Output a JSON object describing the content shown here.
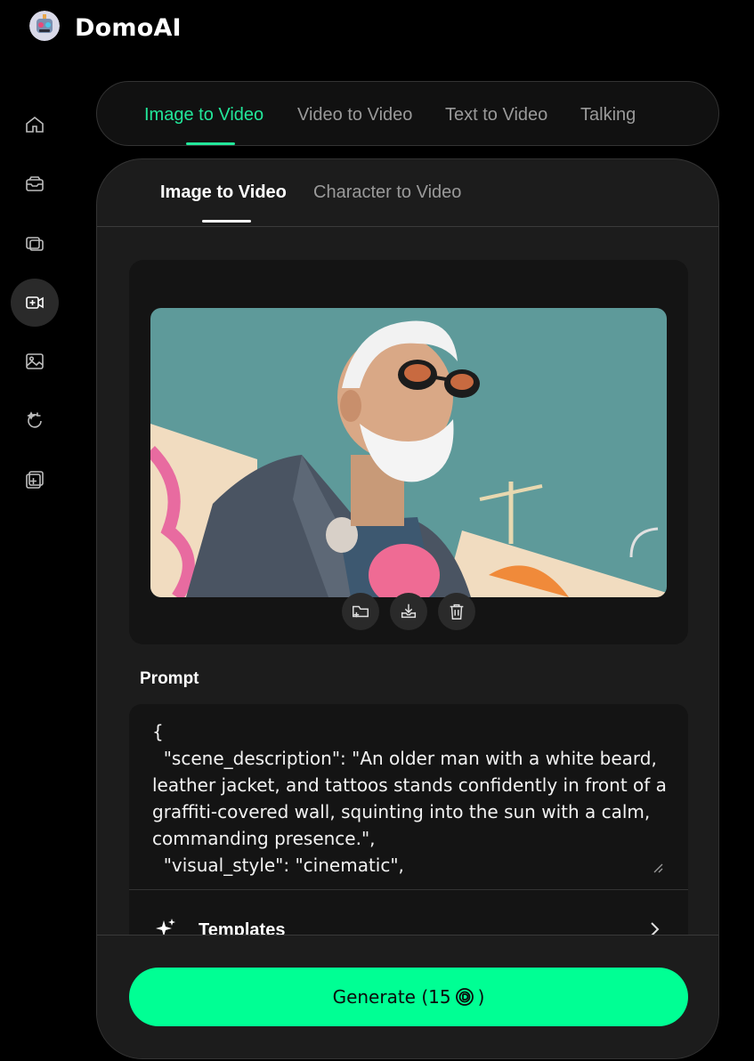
{
  "app": {
    "name": "DomoAI"
  },
  "top_tabs": [
    {
      "label": "Image to Video",
      "active": true
    },
    {
      "label": "Video to Video",
      "active": false
    },
    {
      "label": "Text to Video",
      "active": false
    },
    {
      "label": "Talking",
      "active": false
    }
  ],
  "sub_tabs": [
    {
      "label": "Image to Video",
      "active": true
    },
    {
      "label": "Character to Video",
      "active": false
    }
  ],
  "sidebar": {
    "items": [
      {
        "icon": "home-icon",
        "active": false
      },
      {
        "icon": "inbox-icon",
        "active": false
      },
      {
        "icon": "gallery-icon",
        "active": false
      },
      {
        "icon": "video-plus-icon",
        "active": true
      },
      {
        "icon": "image-icon",
        "active": false
      },
      {
        "icon": "sparkle-refresh-icon",
        "active": false
      },
      {
        "icon": "add-media-icon",
        "active": false
      }
    ]
  },
  "image_actions": [
    "folder-upload-icon",
    "download-icon",
    "trash-icon"
  ],
  "prompt": {
    "label": "Prompt",
    "value": "{\n  \"scene_description\": \"An older man with a white beard, leather jacket, and tattoos stands confidently in front of a graffiti-covered wall, squinting into the sun with a calm, commanding presence.\",\n  \"visual_style\": \"cinematic\","
  },
  "templates": {
    "label": "Templates"
  },
  "generate": {
    "label": "Generate (15",
    "suffix": ")",
    "cost": 15
  },
  "colors": {
    "accent": "#22e79a",
    "button": "#00ff94",
    "panel": "#1c1c1c",
    "background": "#000000"
  }
}
